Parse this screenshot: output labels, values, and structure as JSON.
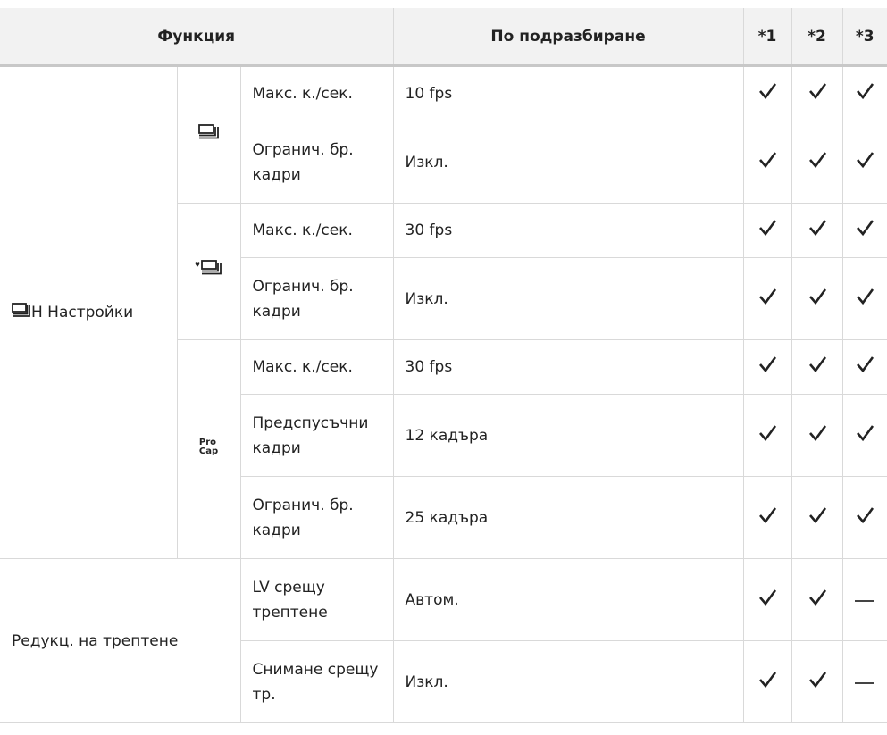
{
  "header": {
    "function": "Функция",
    "default": "По подразбиране",
    "col1": "*1",
    "col2": "*2",
    "col3": "*3"
  },
  "group1": {
    "label": "Н Настройки",
    "icon": "sequential-burst-icon",
    "sub1": {
      "icon": "sequential-burst-icon",
      "rows": [
        {
          "name": "Макс. к./сек.",
          "value": "10 fps"
        },
        {
          "name": "Огранич. бр. кадри",
          "value": "Изкл."
        }
      ]
    },
    "sub2": {
      "icon": "silent-burst-icon",
      "rows": [
        {
          "name": "Макс. к./сек.",
          "value": "30 fps"
        },
        {
          "name": "Огранич. бр. кадри",
          "value": "Изкл."
        }
      ]
    },
    "sub3": {
      "icon_line1": "Pro",
      "icon_line2": "Cap",
      "rows": [
        {
          "name": "Макс. к./сек.",
          "value": "30 fps"
        },
        {
          "name": "Предспусъчни кадри",
          "value": "12 кадъра"
        },
        {
          "name": "Огранич. бр. кадри",
          "value": "25 кадъра"
        }
      ]
    }
  },
  "group2": {
    "label": "Редукц. на трептене",
    "rows": [
      {
        "name": "LV срещу трептене",
        "value": "Автом."
      },
      {
        "name": "Снимане срещу тр.",
        "value": "Изкл."
      }
    ]
  },
  "marks": {
    "check": "checkmark-icon",
    "dash": "dash-icon"
  }
}
